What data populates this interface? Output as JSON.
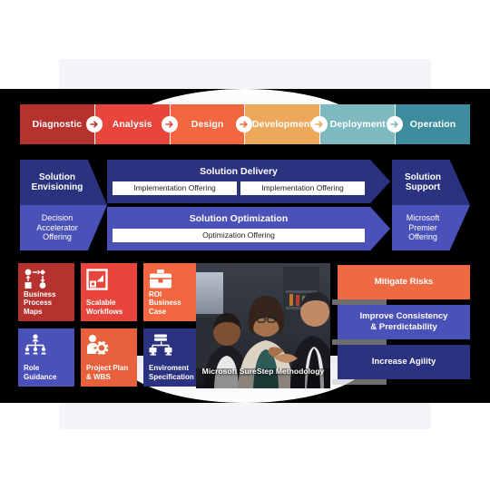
{
  "diagram": {
    "title": "Microsoft SureStep Methodology"
  },
  "phases": {
    "items": [
      {
        "label": "Diagnostic",
        "color": "#b5322e"
      },
      {
        "label": "Analysis",
        "color": "#e8463c"
      },
      {
        "label": "Design",
        "color": "#f26740"
      },
      {
        "label": "Development",
        "color": "#eda85c"
      },
      {
        "label": "Deployment",
        "color": "#7fb9c0"
      },
      {
        "label": "Operation",
        "color": "#3d8d9e"
      }
    ],
    "connector_icon": "arrow-right-icon"
  },
  "envisioning": {
    "top_label": "Solution\nEnvisioning",
    "top_line1": "Solution",
    "top_line2": "Envisioning",
    "bottom_line1": "Decision",
    "bottom_line2": "Accelerator",
    "bottom_line3": "Offering"
  },
  "support": {
    "top_line1": "Solution",
    "top_line2": "Support",
    "bottom_line1": "Microsoft",
    "bottom_line2": "Premier",
    "bottom_line3": "Offering"
  },
  "bands": {
    "delivery": {
      "title": "Solution Delivery",
      "offerings": [
        "Implementation Offering",
        "Implementation Offering"
      ]
    },
    "optimization": {
      "title": "Solution Optimization",
      "offerings": [
        "Optimization Offering"
      ]
    }
  },
  "tiles": [
    {
      "line1": "Business",
      "line2": "Process Maps",
      "color": "#b5322e",
      "icon": "process-map-icon"
    },
    {
      "line1": "Scalable",
      "line2": "Workflows",
      "color": "#e8463c",
      "icon": "scalable-square-icon"
    },
    {
      "line1": "ROI Business",
      "line2": "Case",
      "color": "#f26740",
      "icon": "briefcase-icon"
    },
    {
      "line1": "Role",
      "line2": "Guidance",
      "color": "#4a51b8",
      "icon": "org-chart-icon"
    },
    {
      "line1": "Project Plan",
      "line2": "& WBS",
      "color": "#e8603c",
      "icon": "person-gear-icon"
    },
    {
      "line1": "Enviroment",
      "line2": "Specification",
      "color": "#2b3280",
      "icon": "server-network-icon"
    }
  ],
  "photo": {
    "caption": "Microsoft SureStep Methodology"
  },
  "benefits": [
    {
      "line1": "Mitigate Risks",
      "line2": "",
      "color": "#ef6a43"
    },
    {
      "line1": "Improve Consistency",
      "line2": "& Prerdictability",
      "color": "#4a51b8"
    },
    {
      "line1": "Increase Agility",
      "line2": "",
      "color": "#2b3280"
    }
  ],
  "colors": {
    "navy": "#2b3280",
    "indigo": "#4a51b8",
    "board": "#000000",
    "panel": "#f2f4f8"
  }
}
